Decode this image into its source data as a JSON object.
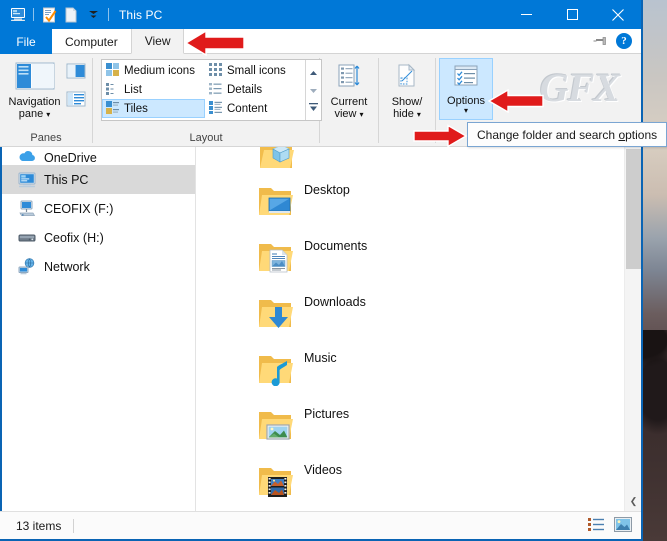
{
  "window": {
    "title": "This PC",
    "quick_access": [
      "this-pc-icon",
      "properties-icon",
      "new-folder-icon",
      "customize-dropdown-icon"
    ],
    "controls": {
      "minimize": "minimize-icon",
      "maximize": "maximize-icon",
      "close": "close-icon"
    }
  },
  "tabs": [
    {
      "label": "File",
      "active": false,
      "kind": "file"
    },
    {
      "label": "Computer",
      "active": false,
      "kind": "normal"
    },
    {
      "label": "View",
      "active": true,
      "kind": "normal"
    }
  ],
  "tab_right": {
    "pin": "pin-ribbon-icon",
    "help": "?"
  },
  "ribbon": {
    "groups": [
      {
        "name": "panes",
        "label": "Panes",
        "big_button": {
          "label_line1": "Navigation",
          "label_line2": "pane",
          "has_caret": true
        },
        "small_buttons": [
          "preview-pane-icon",
          "details-pane-icon"
        ]
      },
      {
        "name": "layout",
        "label": "Layout",
        "items_col1": [
          {
            "label": "Medium icons",
            "selected": false
          },
          {
            "label": "List",
            "selected": false
          },
          {
            "label": "Tiles",
            "selected": true
          }
        ],
        "items_col2": [
          {
            "label": "Small icons",
            "selected": false
          },
          {
            "label": "Details",
            "selected": false
          },
          {
            "label": "Content",
            "selected": false
          }
        ],
        "scroll": [
          "scroll-up-icon",
          "scroll-down-icon",
          "more-icon"
        ]
      },
      {
        "name": "current-view",
        "label": "",
        "button": {
          "line1": "Current",
          "line2": "view",
          "has_caret": true,
          "highlight": false
        }
      },
      {
        "name": "show-hide",
        "label": "",
        "button": {
          "line1": "Show/",
          "line2": "hide",
          "has_caret": true,
          "highlight": false
        }
      },
      {
        "name": "options",
        "label": "",
        "button": {
          "line1": "Options",
          "line2": "",
          "has_caret": true,
          "highlight": true
        }
      }
    ],
    "dialog_launcher": "dialog-box-launcher",
    "watermark": "GFX"
  },
  "tooltip": {
    "text_before": "Change folder and search ",
    "accesskey": "o",
    "text_after": "ptions"
  },
  "sidebar": {
    "items": [
      {
        "label": "OneDrive",
        "icon": "onedrive-icon",
        "selected": false,
        "clipped": true
      },
      {
        "label": "This PC",
        "icon": "this-pc-icon",
        "selected": true,
        "clipped": false
      },
      {
        "label": "CEOFIX (F:)",
        "icon": "network-drive-icon",
        "selected": false,
        "clipped": false
      },
      {
        "label": "Ceofix (H:)",
        "icon": "hard-drive-icon",
        "selected": false,
        "clipped": false
      },
      {
        "label": "Network",
        "icon": "network-icon",
        "selected": false,
        "clipped": false
      }
    ]
  },
  "content": {
    "items": [
      {
        "label": "",
        "icon": "3d-objects-folder-icon",
        "clipped": true
      },
      {
        "label": "Desktop",
        "icon": "desktop-folder-icon",
        "clipped": false
      },
      {
        "label": "Documents",
        "icon": "documents-folder-icon",
        "clipped": false
      },
      {
        "label": "Downloads",
        "icon": "downloads-folder-icon",
        "clipped": false
      },
      {
        "label": "Music",
        "icon": "music-folder-icon",
        "clipped": false
      },
      {
        "label": "Pictures",
        "icon": "pictures-folder-icon",
        "clipped": false
      },
      {
        "label": "Videos",
        "icon": "videos-folder-icon",
        "clipped": false
      }
    ]
  },
  "statusbar": {
    "count": "13 items",
    "view_buttons": [
      "details-view-icon",
      "large-icons-view-icon"
    ]
  },
  "annotations": {
    "arrows": [
      {
        "name": "arrow-pointing-to-view-tab",
        "direction": "left"
      },
      {
        "name": "arrow-pointing-to-options-button",
        "direction": "left"
      },
      {
        "name": "arrow-pointing-to-dialog-launcher",
        "direction": "right"
      }
    ]
  },
  "colors": {
    "accent": "#0078d7",
    "window_border": "#0a64b4",
    "selection": "#cce8ff",
    "nav_selection": "#d9d9d9",
    "arrow_red": "#e01b1b",
    "folder_yellow": "#ffd064"
  }
}
